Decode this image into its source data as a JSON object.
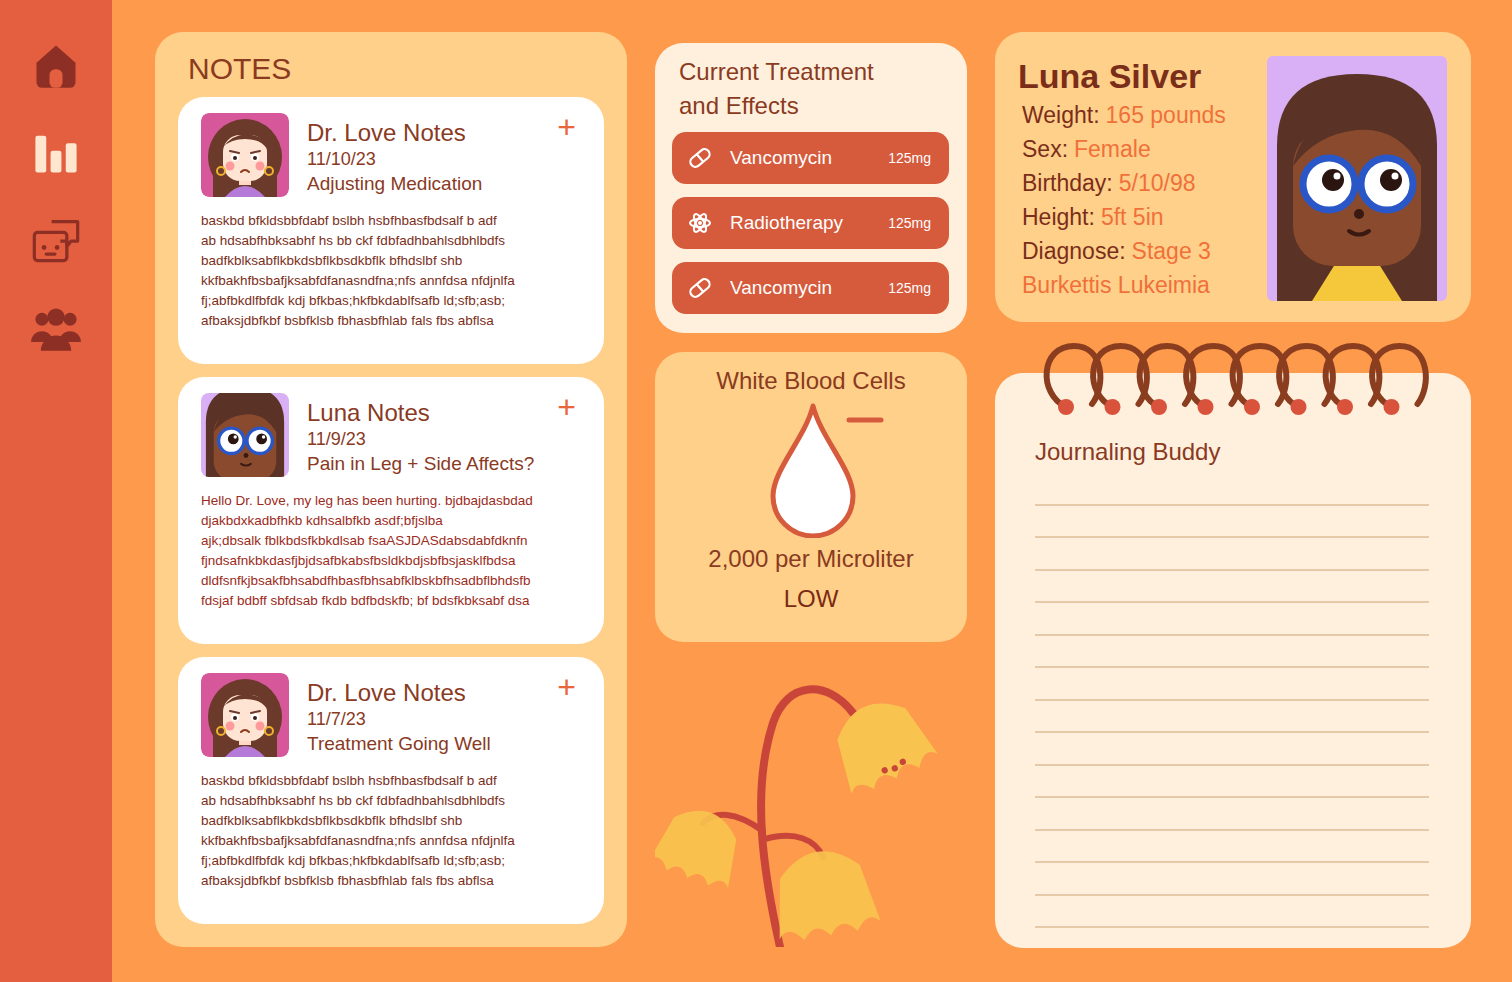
{
  "sidebar": {
    "items": [
      {
        "kind": "home",
        "selected": false
      },
      {
        "kind": "stats",
        "selected": true
      },
      {
        "kind": "messages",
        "selected": false
      },
      {
        "kind": "team",
        "selected": false
      }
    ]
  },
  "notes": {
    "title": "NOTES",
    "items": [
      {
        "kind": "doctor",
        "author": "Dr. Love Notes",
        "date": "11/10/23",
        "subject": "Adjusting Medication",
        "add": "+",
        "body": [
          "baskbd bfkldsbbfdabf bslbh hsbfhbasfbdsalf b adf",
          "ab hdsabfhbksabhf hs bb ckf fdbfadhbahlsdbhlbdfs",
          "badfkblksabflkbkdsbflkbsdkbflk bfhdslbf shb",
          "kkfbakhfbsbafjksabfdfanasndfna;nfs annfdsa nfdjnlfa",
          "fj;abfbkdlfbfdk kdj bfkbas;hkfbkdablfsafb ld;sfb;asb;",
          "afbaksjdbfkbf bsbfklsb fbhasbfhlab fals fbs abflsa"
        ]
      },
      {
        "kind": "patient",
        "author": "Luna Notes",
        "date": "11/9/23",
        "subject": "Pain in Leg + Side Affects?",
        "add": "+",
        "body": [
          "Hello Dr. Love, my leg has been hurting. bjdbajdasbdad",
          "djakbdxkadbfhkb kdhsalbfkb asdf;bfjslba",
          "ajk;dbsalk fblkbdsfkbkdlsab fsaASJDASdabsdabfdknfn",
          "fjndsafnkbkdasfjbjdsafbkabsfbsldkbdjsbfbsjasklfbdsa",
          "dldfsnfkjbsakfbhsabdfhbasfbhsabfklbskbfhsadbflbhdsfb",
          "fdsjaf bdbff sbfdsab fkdb bdfbdskfb; bf bdsfkbksabf dsa"
        ]
      },
      {
        "kind": "doctor",
        "author": "Dr. Love Notes",
        "date": "11/7/23",
        "subject": "Treatment Going Well",
        "add": "+",
        "body": [
          "baskbd bfkldsbbfdabf bslbh hsbfhbasfbdsalf b adf",
          "ab hdsabfhbksabhf hs bb ckf fdbfadhbahlsdbhlbdfs",
          "badfkblksabflkbkdsbflkbsdkbflk bfhdslbf shb",
          "kkfbakhfbsbafjksabfdfanasndfna;nfs annfdsa nfdjnlfa",
          "fj;abfbkdlfbfdk kdj bfkbas;hkfbkdablfsafb ld;sfb;asb;",
          "afbaksjdbfkbf bsbfklsb fbhasbfhlab fals fbs abflsa"
        ]
      }
    ]
  },
  "treatment": {
    "title": "Current Treatment and Effects",
    "items": [
      {
        "kind": "pill",
        "name": "Vancomycin",
        "dose": "125mg"
      },
      {
        "kind": "radiation",
        "name": "Radiotherapy",
        "dose": "125mg"
      },
      {
        "kind": "pill",
        "name": "Vancomycin",
        "dose": "125mg"
      }
    ]
  },
  "white_blood_cells": {
    "title": "White Blood Cells",
    "reading": "2,000 per Microliter",
    "status": "LOW",
    "low": true
  },
  "profile": {
    "name": "Luna Silver",
    "fields": [
      {
        "label": "Weight:",
        "value": "165 pounds"
      },
      {
        "label": "Sex:",
        "value": "Female"
      },
      {
        "label": "Birthday:",
        "value": "5/10/98"
      },
      {
        "label": "Height:",
        "value": "5ft 5in"
      },
      {
        "label": "Diagnose:",
        "value": "Stage 3 Burkettis Lukeimia"
      }
    ]
  },
  "journal": {
    "title": "Journaling Buddy"
  }
}
